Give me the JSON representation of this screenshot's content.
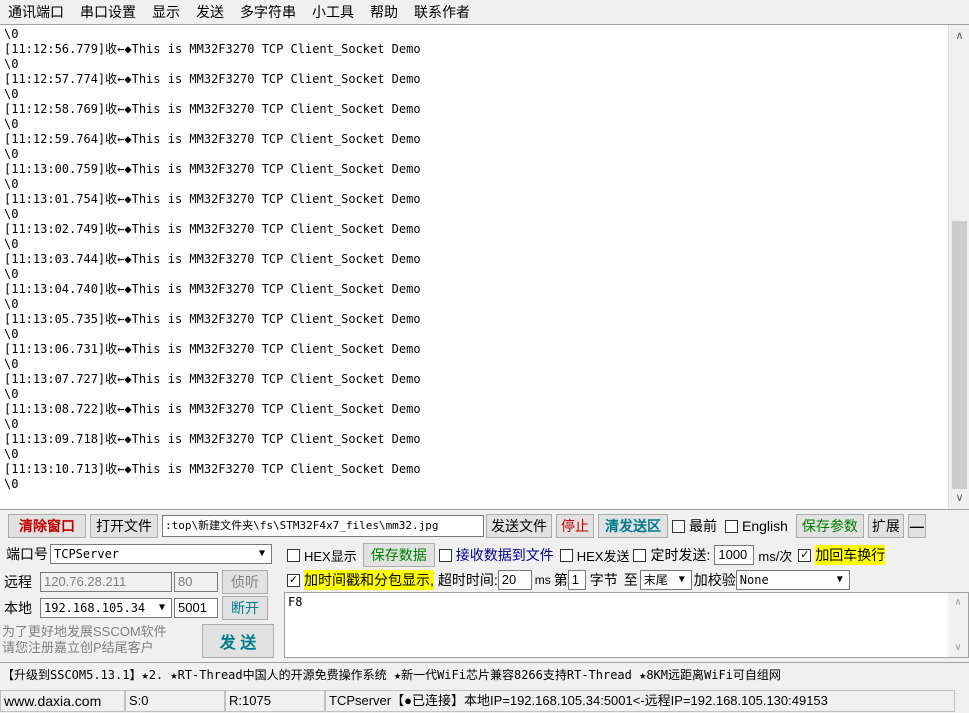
{
  "menu": [
    "通讯端口",
    "串口设置",
    "显示",
    "发送",
    "多字符串",
    "小工具",
    "帮助",
    "联系作者"
  ],
  "log": {
    "lines": [
      "\\0",
      "[11:12:56.779]收←◆This is MM32F3270 TCP Client_Socket Demo",
      "\\0",
      "[11:12:57.774]收←◆This is MM32F3270 TCP Client_Socket Demo",
      "\\0",
      "[11:12:58.769]收←◆This is MM32F3270 TCP Client_Socket Demo",
      "\\0",
      "[11:12:59.764]收←◆This is MM32F3270 TCP Client_Socket Demo",
      "\\0",
      "[11:13:00.759]收←◆This is MM32F3270 TCP Client_Socket Demo",
      "\\0",
      "[11:13:01.754]收←◆This is MM32F3270 TCP Client_Socket Demo",
      "\\0",
      "[11:13:02.749]收←◆This is MM32F3270 TCP Client_Socket Demo",
      "\\0",
      "[11:13:03.744]收←◆This is MM32F3270 TCP Client_Socket Demo",
      "\\0",
      "[11:13:04.740]收←◆This is MM32F3270 TCP Client_Socket Demo",
      "\\0",
      "[11:13:05.735]收←◆This is MM32F3270 TCP Client_Socket Demo",
      "\\0",
      "[11:13:06.731]收←◆This is MM32F3270 TCP Client_Socket Demo",
      "\\0",
      "[11:13:07.727]收←◆This is MM32F3270 TCP Client_Socket Demo",
      "\\0",
      "[11:13:08.722]收←◆This is MM32F3270 TCP Client_Socket Demo",
      "\\0",
      "[11:13:09.718]收←◆This is MM32F3270 TCP Client_Socket Demo",
      "\\0",
      "[11:13:10.713]收←◆This is MM32F3270 TCP Client_Socket Demo",
      "\\0"
    ]
  },
  "toolbar": {
    "clear_window": "清除窗口",
    "open_file": "打开文件",
    "file_path": ":top\\新建文件夹\\fs\\STM32F4x7_files\\mm32.jpg",
    "send_file": "发送文件",
    "stop": "停止",
    "clear_send": "清发送区",
    "topmost": "最前",
    "english": "English",
    "save_params": "保存参数",
    "expand": "扩展",
    "collapse": "—"
  },
  "conn": {
    "port_label": "端口号",
    "port_value": "TCPServer",
    "remote_label": "远程",
    "remote_ip": "120.76.28.211",
    "remote_port": "80",
    "listen": "侦听",
    "local_label": "本地",
    "local_ip": "192.168.105.34",
    "local_port": "5001",
    "disconnect": "断开",
    "promo_line1": "为了更好地发展SSCOM软件",
    "promo_line2": "请您注册嘉立创P结尾客户",
    "send_btn": "发 送"
  },
  "options": {
    "hex_display": "HEX显示",
    "save_data": "保存数据",
    "recv_to_file": "接收数据到文件",
    "hex_send": "HEX发送",
    "timed_send": "定时发送:",
    "interval": "1000",
    "interval_unit": "ms/次",
    "add_crlf": "加回车换行",
    "timestamp": "加时间戳和分包显示,",
    "timeout_label": "超时时间:",
    "timeout_value": "20",
    "timeout_unit": "ms",
    "nth_label": "第",
    "nth_value": "1",
    "byte_label": "字节",
    "to_label": "至",
    "to_value": "末尾",
    "checksum_label": "加校验",
    "checksum_value": "None"
  },
  "send_text": "F8",
  "promo_bar": "【升级到SSCOM5.13.1】★2. ★RT-Thread中国人的开源免费操作系统 ★新一代WiFi芯片兼容8266支持RT-Thread ★8KM远距离WiFi可自组网",
  "status": {
    "website": "www.daxia.com",
    "sent": "S:0",
    "received": "R:1075",
    "conn_info": "TCPserver【●已连接】本地IP=192.168.105.34:5001<-远程IP=192.168.105.130:49153"
  }
}
